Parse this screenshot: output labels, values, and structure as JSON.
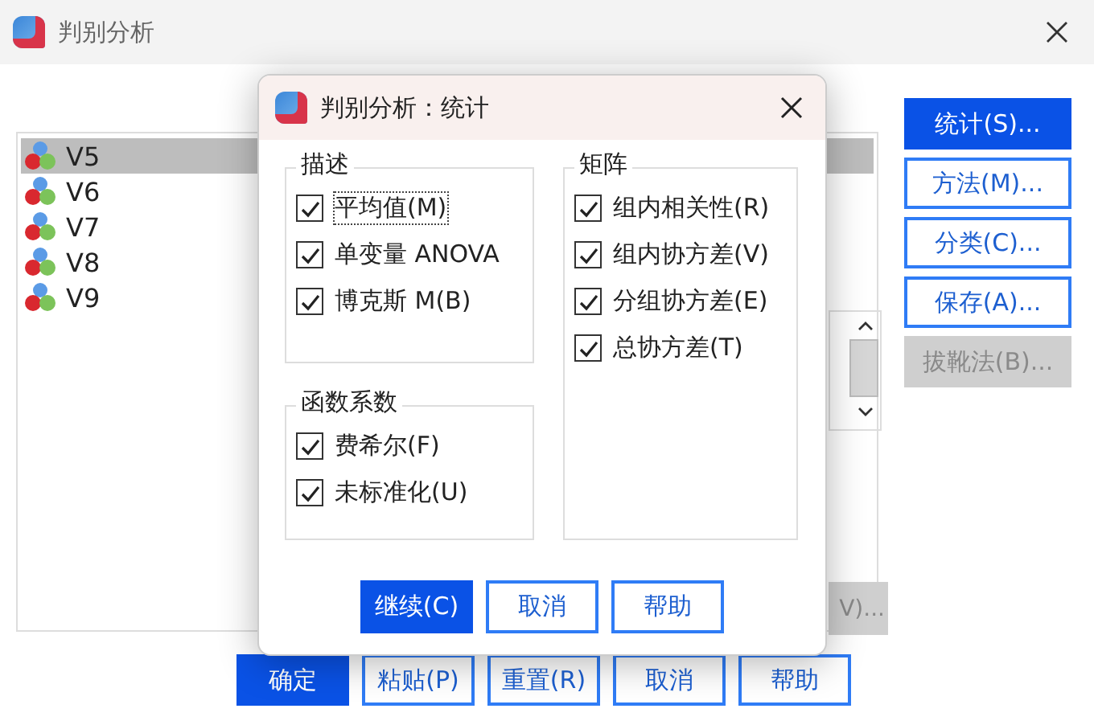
{
  "window": {
    "title": "判别分析"
  },
  "variables": [
    {
      "name": "V5",
      "selected": true
    },
    {
      "name": "V6",
      "selected": false
    },
    {
      "name": "V7",
      "selected": false
    },
    {
      "name": "V8",
      "selected": false
    },
    {
      "name": "V9",
      "selected": false
    }
  ],
  "hidden_button": {
    "label": "V)...",
    "disabled": true
  },
  "side_buttons": [
    {
      "label": "统计(S)...",
      "selected": true,
      "disabled": false
    },
    {
      "label": "方法(M)...",
      "selected": false,
      "disabled": false
    },
    {
      "label": "分类(C)...",
      "selected": false,
      "disabled": false
    },
    {
      "label": "保存(A)...",
      "selected": false,
      "disabled": false
    },
    {
      "label": "拔靴法(B)...",
      "selected": false,
      "disabled": true
    }
  ],
  "bottom_buttons": [
    {
      "label": "确定",
      "default": true
    },
    {
      "label": "粘贴(P)",
      "default": false
    },
    {
      "label": "重置(R)",
      "default": false
    },
    {
      "label": "取消",
      "default": false
    },
    {
      "label": "帮助",
      "default": false
    }
  ],
  "dialog": {
    "title": "判别分析：统计",
    "groups": [
      {
        "title": "描述",
        "items": [
          {
            "label": "平均值(M)",
            "checked": true,
            "focused": true
          },
          {
            "label": "单变量 ANOVA",
            "checked": true,
            "focused": false
          },
          {
            "label": "博克斯 M(B)",
            "checked": true,
            "focused": false
          }
        ]
      },
      {
        "title": "函数系数",
        "items": [
          {
            "label": "费希尔(F)",
            "checked": true,
            "focused": false
          },
          {
            "label": "未标准化(U)",
            "checked": true,
            "focused": false
          }
        ]
      },
      {
        "title": "矩阵",
        "items": [
          {
            "label": "组内相关性(R)",
            "checked": true,
            "focused": false
          },
          {
            "label": "组内协方差(V)",
            "checked": true,
            "focused": false
          },
          {
            "label": "分组协方差(E)",
            "checked": true,
            "focused": false
          },
          {
            "label": "总协方差(T)",
            "checked": true,
            "focused": false
          }
        ]
      }
    ],
    "buttons": [
      {
        "label": "继续(C)",
        "default": true
      },
      {
        "label": "取消",
        "default": false
      },
      {
        "label": "帮助",
        "default": false
      }
    ]
  }
}
